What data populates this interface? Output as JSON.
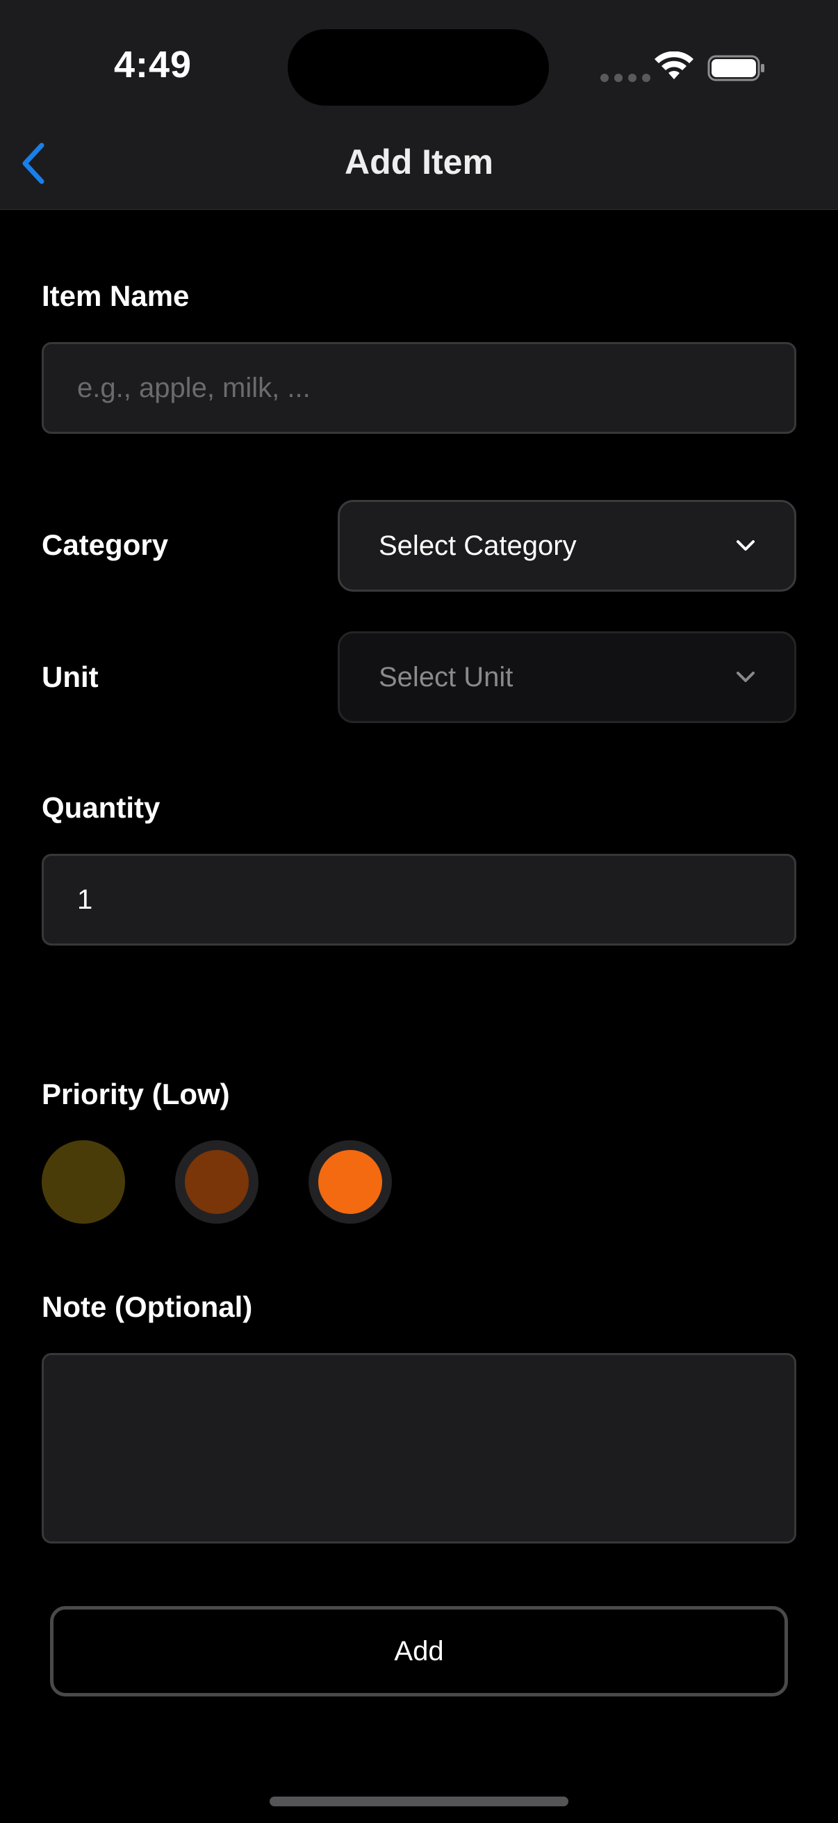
{
  "status_bar": {
    "time": "4:49"
  },
  "nav": {
    "back_icon": "chevron-left-icon",
    "title": "Add Item",
    "accent_color": "#1a7fe8"
  },
  "form": {
    "item_name": {
      "label": "Item Name",
      "placeholder": "e.g., apple, milk, ...",
      "value": ""
    },
    "category": {
      "label": "Category",
      "selected": "Select Category",
      "icon": "chevron-down-icon"
    },
    "unit": {
      "label": "Unit",
      "selected": "Select Unit",
      "icon": "chevron-down-icon"
    },
    "quantity": {
      "label": "Quantity",
      "value": "1"
    },
    "priority": {
      "label": "Priority (Low)",
      "options": [
        {
          "color": "#4a3c08",
          "selected": true
        },
        {
          "color": "#7a3508",
          "selected": false
        },
        {
          "color": "#f36a10",
          "selected": false
        }
      ]
    },
    "note": {
      "label": "Note (Optional)",
      "value": ""
    },
    "submit_label": "Add"
  }
}
